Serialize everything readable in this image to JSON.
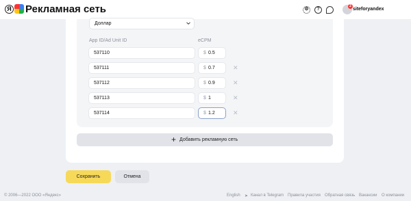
{
  "header": {
    "logo_letter": "Я",
    "logo_text": "Рекламная сеть",
    "settings_icon": "gear-icon",
    "help_icon": "question-icon",
    "chat_icon": "chat-bubble-icon",
    "notification_count": "2",
    "username": "siteforyandex"
  },
  "form": {
    "currency_value": "Доллар",
    "col_id_label": "App ID/Ad Unit ID",
    "col_ecpm_label": "eCPM",
    "currency_symbol": "$",
    "rows": [
      {
        "id": "537110",
        "ecpm": "0.5",
        "removable": false
      },
      {
        "id": "537111",
        "ecpm": "0.7",
        "removable": true
      },
      {
        "id": "537112",
        "ecpm": "0.9",
        "removable": true
      },
      {
        "id": "537113",
        "ecpm": "1",
        "removable": true
      },
      {
        "id": "537114",
        "ecpm": "1.2",
        "removable": true
      }
    ],
    "add_network_label": "Добавить рекламную сеть",
    "save_label": "Сохранить",
    "cancel_label": "Отмена"
  },
  "footer": {
    "copyright": "© 2006—2022 ООО «Яндекс»",
    "links": [
      "English",
      "Канал в Telegram",
      "Правила участия",
      "Обратная связь",
      "Вакансии",
      "О компании"
    ]
  },
  "colors": {
    "accent_yellow": "#f7d959",
    "background": "#eef0f4",
    "card": "#ffffff",
    "inner_panel": "#f4f5f7"
  }
}
